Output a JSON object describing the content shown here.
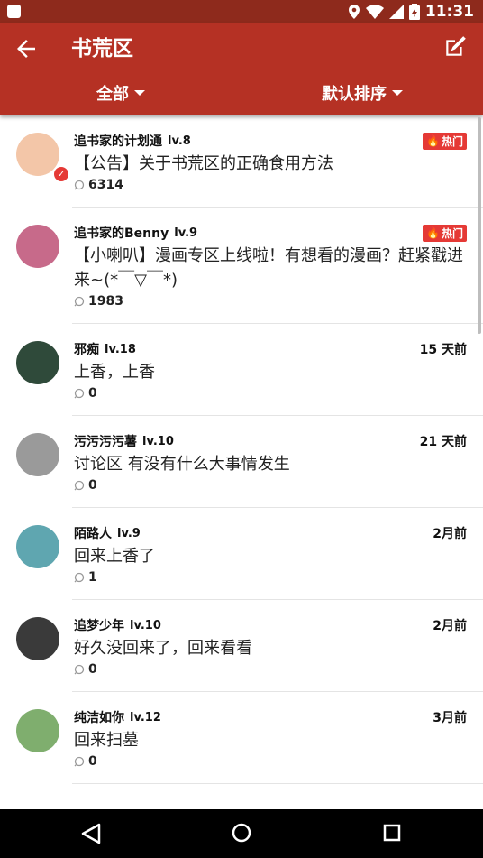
{
  "status_bar": {
    "time": "11:31"
  },
  "toolbar": {
    "title": "书荒区"
  },
  "filters": {
    "category": "全部",
    "sort": "默认排序"
  },
  "posts": [
    {
      "user": "追书家的计划通",
      "level": "lv.8",
      "title": "【公告】关于书荒区的正确食用方法",
      "comments": "6314",
      "tag": "热门",
      "time": "",
      "avatar_color": "#f3c6a8",
      "verified": true
    },
    {
      "user": "追书家的Benny",
      "level": "lv.9",
      "title": "【小喇叭】漫画专区上线啦！有想看的漫画？赶紧戳进来~(*￣▽￣*)",
      "comments": "1983",
      "tag": "热门",
      "time": "",
      "avatar_color": "#c76a8a",
      "verified": false
    },
    {
      "user": "邪痴",
      "level": "lv.18",
      "title": "上香，上香",
      "comments": "0",
      "tag": "",
      "time": "15 天前",
      "avatar_color": "#2f4a3a",
      "verified": false
    },
    {
      "user": "污污污污薯",
      "level": "lv.10",
      "title": "讨论区 有没有什么大事情发生",
      "comments": "0",
      "tag": "",
      "time": "21 天前",
      "avatar_color": "#9a9a9a",
      "verified": false
    },
    {
      "user": "陌路人",
      "level": "lv.9",
      "title": "回来上香了",
      "comments": "1",
      "tag": "",
      "time": "2月前",
      "avatar_color": "#5fa6b0",
      "verified": false
    },
    {
      "user": "追梦少年",
      "level": "lv.10",
      "title": "好久没回来了，回来看看",
      "comments": "0",
      "tag": "",
      "time": "2月前",
      "avatar_color": "#3a3a3a",
      "verified": false
    },
    {
      "user": "纯洁如你",
      "level": "lv.12",
      "title": "回来扫墓",
      "comments": "0",
      "tag": "",
      "time": "3月前",
      "avatar_color": "#7fae6e",
      "verified": false
    }
  ]
}
